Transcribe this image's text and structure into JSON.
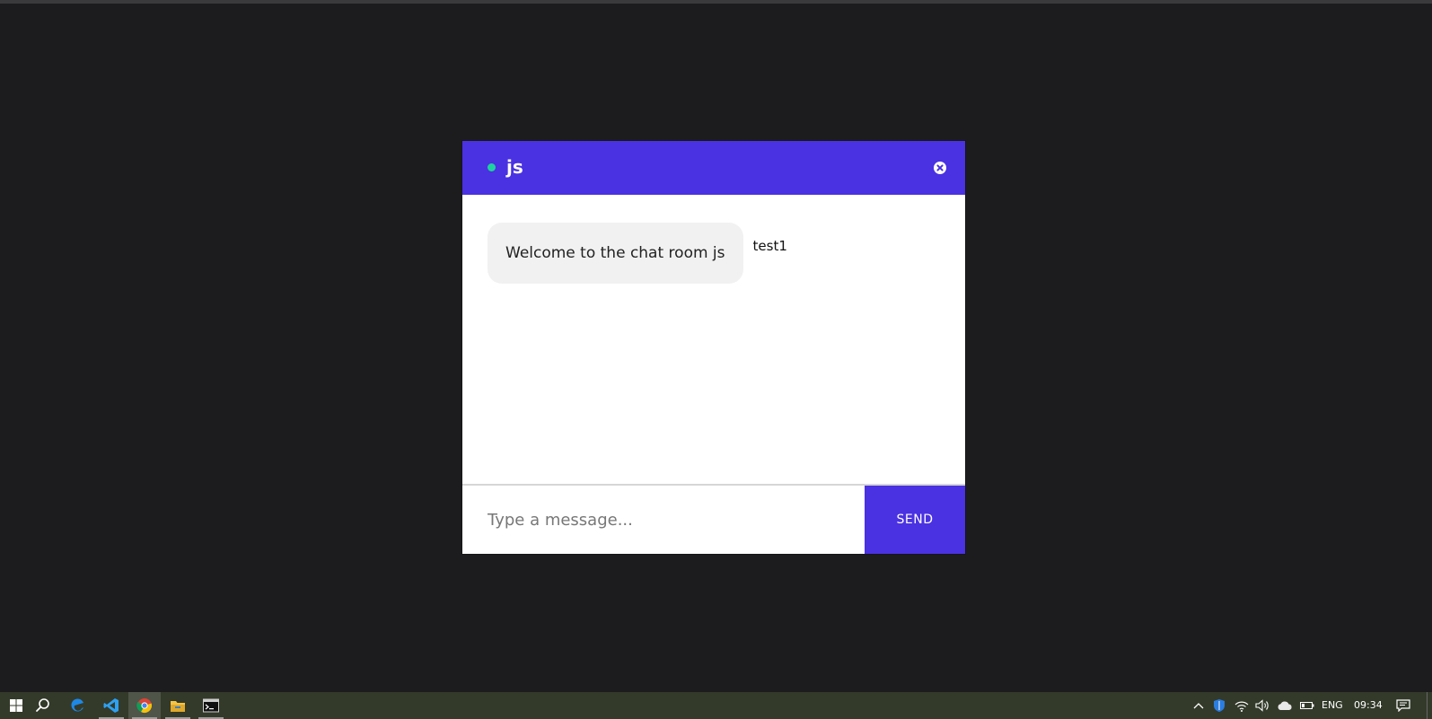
{
  "chat": {
    "room_name": "js",
    "status": "online",
    "messages": [
      {
        "text": "Welcome to the chat room js",
        "sender": "test1"
      }
    ],
    "input": {
      "value": "",
      "placeholder": "Type a message..."
    },
    "send_label": "SEND"
  },
  "colors": {
    "page_background": "#1c1c1e",
    "accent": "#4a32e2",
    "status_dot": "#1ed2a0",
    "bubble": "#f1f1f1",
    "taskbar": "#333a2a"
  },
  "taskbar": {
    "apps": [
      {
        "icon": "windows-start-icon",
        "state": "normal"
      },
      {
        "icon": "search-icon",
        "state": "normal"
      },
      {
        "icon": "edge-icon",
        "state": "normal"
      },
      {
        "icon": "vscode-icon",
        "state": "open"
      },
      {
        "icon": "chrome-icon",
        "state": "active"
      },
      {
        "icon": "file-explorer-icon",
        "state": "open"
      },
      {
        "icon": "terminal-icon",
        "state": "open"
      }
    ],
    "tray": {
      "icons": [
        "show-hidden-icons-chevron-icon",
        "defender-icon",
        "wifi-icon",
        "volume-icon",
        "onedrive-icon",
        "battery-icon",
        "notifications-icon"
      ],
      "language": "ENG",
      "time": "09:34"
    }
  }
}
